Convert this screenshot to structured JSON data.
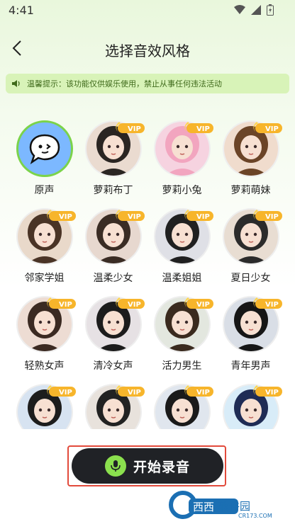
{
  "status_bar": {
    "time": "4:41",
    "icons": [
      "wifi-icon",
      "signal-icon",
      "battery-icon"
    ]
  },
  "header": {
    "title": "选择音效风格",
    "back_icon": "chevron-left-icon"
  },
  "notice": {
    "icon": "speaker-icon",
    "text": "温馨提示：该功能仅供娱乐使用，禁止从事任何违法活动"
  },
  "badge": {
    "vip": "VIP"
  },
  "styles": [
    {
      "name": "原声",
      "vip": false,
      "selected": true
    },
    {
      "name": "萝莉布丁",
      "vip": true,
      "selected": false
    },
    {
      "name": "萝莉小兔",
      "vip": true,
      "selected": false
    },
    {
      "name": "萝莉萌妹",
      "vip": true,
      "selected": false
    },
    {
      "name": "邻家学姐",
      "vip": true,
      "selected": false
    },
    {
      "name": "温柔少女",
      "vip": true,
      "selected": false
    },
    {
      "name": "温柔姐姐",
      "vip": true,
      "selected": false
    },
    {
      "name": "夏日少女",
      "vip": true,
      "selected": false
    },
    {
      "name": "轻熟女声",
      "vip": true,
      "selected": false
    },
    {
      "name": "清冷女声",
      "vip": true,
      "selected": false
    },
    {
      "name": "活力男生",
      "vip": true,
      "selected": false
    },
    {
      "name": "青年男声",
      "vip": true,
      "selected": false
    },
    {
      "name": "",
      "vip": true,
      "selected": false
    },
    {
      "name": "",
      "vip": true,
      "selected": false
    },
    {
      "name": "",
      "vip": true,
      "selected": false
    },
    {
      "name": "",
      "vip": true,
      "selected": false
    }
  ],
  "record": {
    "label": "开始录音",
    "icon": "microphone-icon"
  },
  "watermark": {
    "brand": "西西软件园",
    "domain": "CR173.COM"
  },
  "colors": {
    "accent": "#8be04e",
    "notice_bg": "#d8f3b8",
    "button_bg": "#202226",
    "vip": "#f7b52b",
    "highlight": "#e24a3b"
  }
}
